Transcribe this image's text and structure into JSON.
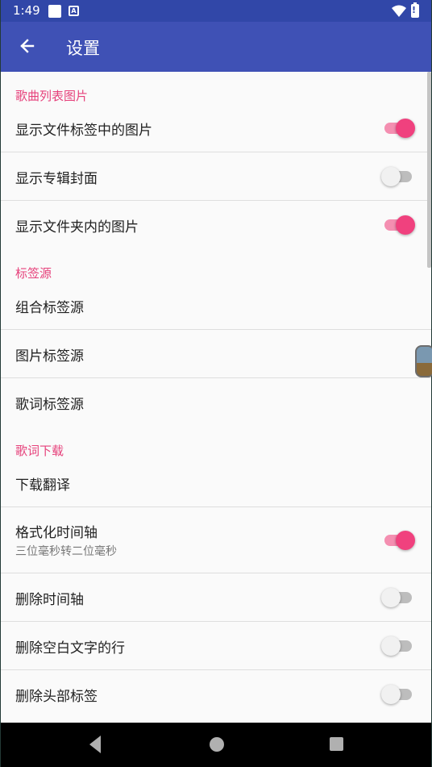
{
  "status_bar": {
    "time": "1:49",
    "notification_badge": "A",
    "battery_glyph": "!"
  },
  "app_bar": {
    "title": "设置",
    "back_icon": "arrow-back-icon"
  },
  "colors": {
    "primary": "#3f51b5",
    "primary_dark": "#3147a8",
    "accent": "#f0417e"
  },
  "settings": {
    "artwork": {
      "header": "歌曲列表图片",
      "items": [
        {
          "title": "显示文件标签中的图片",
          "enabled": true
        },
        {
          "title": "显示专辑封面",
          "enabled": false
        },
        {
          "title": "显示文件夹内的图片",
          "enabled": true
        }
      ]
    },
    "tag_source": {
      "header": "标签源",
      "items": [
        {
          "title": "组合标签源"
        },
        {
          "title": "图片标签源"
        },
        {
          "title": "歌词标签源"
        }
      ]
    },
    "lyrics": {
      "header": "歌词下载",
      "items": [
        {
          "title": "下载翻译"
        },
        {
          "title": "格式化时间轴",
          "summary": "三位毫秒转二位毫秒",
          "enabled": true
        },
        {
          "title": "删除时间轴",
          "enabled": false
        },
        {
          "title": "删除空白文字的行",
          "enabled": false
        },
        {
          "title": "删除头部标签",
          "enabled": false
        }
      ]
    }
  },
  "nav_bar": {
    "back": "triangle-back-icon",
    "home": "circle-home-icon",
    "recents": "square-recents-icon"
  }
}
